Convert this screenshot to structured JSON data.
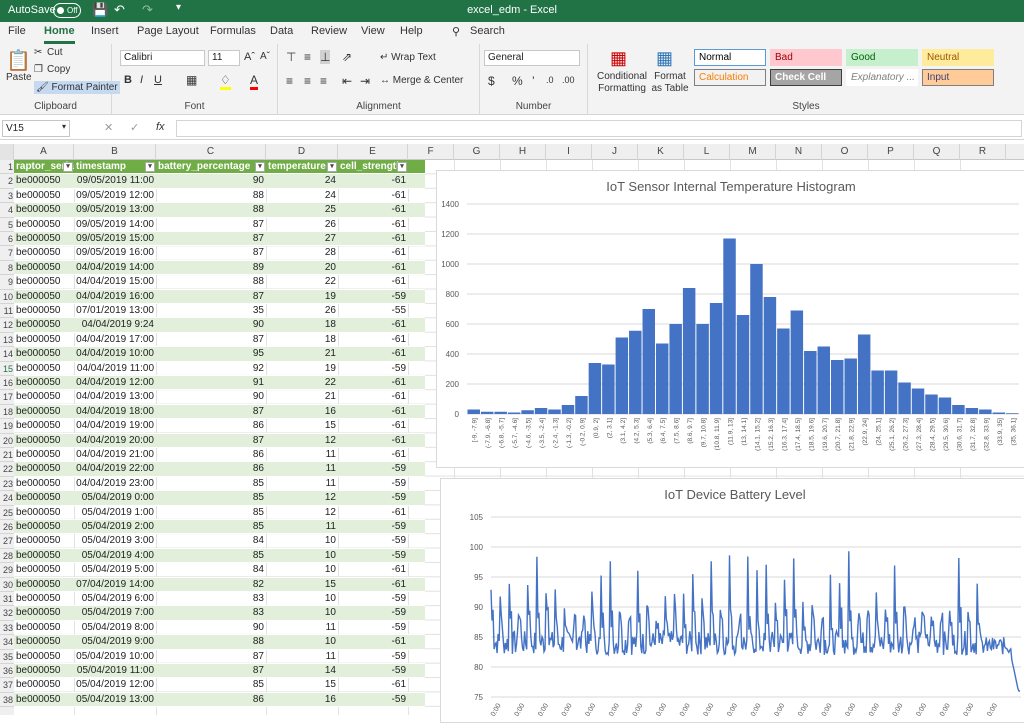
{
  "titlebar": {
    "autosave": "AutoSave",
    "autosave_state": "Off",
    "title": "excel_edm  -  Excel"
  },
  "tabs": [
    {
      "label": "File",
      "x": 8
    },
    {
      "label": "Home",
      "x": 44,
      "active": true
    },
    {
      "label": "Insert",
      "x": 91
    },
    {
      "label": "Page Layout",
      "x": 137
    },
    {
      "label": "Formulas",
      "x": 210
    },
    {
      "label": "Data",
      "x": 270
    },
    {
      "label": "Review",
      "x": 311
    },
    {
      "label": "View",
      "x": 361
    },
    {
      "label": "Help",
      "x": 400
    }
  ],
  "search_label": "Search",
  "ribbon": {
    "clipboard": {
      "paste": "Paste",
      "cut": "Cut",
      "copy": "Copy",
      "format_painter": "Format Painter",
      "label": "Clipboard"
    },
    "font": {
      "name": "Calibri",
      "size": "11",
      "label": "Font"
    },
    "alignment": {
      "wrap": "Wrap Text",
      "merge": "Merge & Center",
      "label": "Alignment"
    },
    "number": {
      "format": "General",
      "label": "Number"
    },
    "styles": {
      "conditional": "Conditional Formatting",
      "format_table": "Format as Table",
      "label": "Styles",
      "cells": [
        {
          "label": "Normal",
          "bg": "#ffffff",
          "fg": "#000000",
          "border": "#5b9bd5"
        },
        {
          "label": "Bad",
          "bg": "#ffc7ce",
          "fg": "#9c0006",
          "border": "#ffc7ce"
        },
        {
          "label": "Good",
          "bg": "#c6efce",
          "fg": "#006100",
          "border": "#c6efce"
        },
        {
          "label": "Neutral",
          "bg": "#ffeb9c",
          "fg": "#9c5700",
          "border": "#ffeb9c"
        },
        {
          "label": "Calculation",
          "bg": "#f2f2f2",
          "fg": "#fa7d00",
          "border": "#7f7f7f"
        },
        {
          "label": "Check Cell",
          "bg": "#a5a5a5",
          "fg": "#ffffff",
          "border": "#3f3f3f"
        },
        {
          "label": "Explanatory ...",
          "bg": "#ffffff",
          "fg": "#7f7f7f",
          "border": "#ffffff"
        },
        {
          "label": "Input",
          "bg": "#ffcc99",
          "fg": "#3f3f76",
          "border": "#7f7f7f"
        }
      ]
    }
  },
  "namebox": "V15",
  "columns": [
    "A",
    "B",
    "C",
    "D",
    "E",
    "F",
    "G",
    "H",
    "I",
    "J",
    "K",
    "L",
    "M",
    "N",
    "O",
    "P",
    "Q",
    "R"
  ],
  "table_headers": [
    "raptor_serial",
    "timestamp",
    "battery_percentage",
    "temperature",
    "cell_strength"
  ],
  "rows": [
    [
      "be000050",
      "09/05/2019 11:00",
      "90",
      "24",
      "-61"
    ],
    [
      "be000050",
      "09/05/2019 12:00",
      "88",
      "24",
      "-61"
    ],
    [
      "be000050",
      "09/05/2019 13:00",
      "88",
      "25",
      "-61"
    ],
    [
      "be000050",
      "09/05/2019 14:00",
      "87",
      "26",
      "-61"
    ],
    [
      "be000050",
      "09/05/2019 15:00",
      "87",
      "27",
      "-61"
    ],
    [
      "be000050",
      "09/05/2019 16:00",
      "87",
      "28",
      "-61"
    ],
    [
      "be000050",
      "04/04/2019 14:00",
      "89",
      "20",
      "-61"
    ],
    [
      "be000050",
      "04/04/2019 15:00",
      "88",
      "22",
      "-61"
    ],
    [
      "be000050",
      "04/04/2019 16:00",
      "87",
      "19",
      "-59"
    ],
    [
      "be000050",
      "07/01/2019 13:00",
      "35",
      "26",
      "-55"
    ],
    [
      "be000050",
      "04/04/2019 9:24",
      "90",
      "18",
      "-61"
    ],
    [
      "be000050",
      "04/04/2019 17:00",
      "87",
      "18",
      "-61"
    ],
    [
      "be000050",
      "04/04/2019 10:00",
      "95",
      "21",
      "-61"
    ],
    [
      "be000050",
      "04/04/2019 11:00",
      "92",
      "19",
      "-59"
    ],
    [
      "be000050",
      "04/04/2019 12:00",
      "91",
      "22",
      "-61"
    ],
    [
      "be000050",
      "04/04/2019 13:00",
      "90",
      "21",
      "-61"
    ],
    [
      "be000050",
      "04/04/2019 18:00",
      "87",
      "16",
      "-61"
    ],
    [
      "be000050",
      "04/04/2019 19:00",
      "86",
      "15",
      "-61"
    ],
    [
      "be000050",
      "04/04/2019 20:00",
      "87",
      "12",
      "-61"
    ],
    [
      "be000050",
      "04/04/2019 21:00",
      "86",
      "11",
      "-61"
    ],
    [
      "be000050",
      "04/04/2019 22:00",
      "86",
      "11",
      "-59"
    ],
    [
      "be000050",
      "04/04/2019 23:00",
      "85",
      "11",
      "-59"
    ],
    [
      "be000050",
      "05/04/2019 0:00",
      "85",
      "12",
      "-59"
    ],
    [
      "be000050",
      "05/04/2019 1:00",
      "85",
      "12",
      "-61"
    ],
    [
      "be000050",
      "05/04/2019 2:00",
      "85",
      "11",
      "-59"
    ],
    [
      "be000050",
      "05/04/2019 3:00",
      "84",
      "10",
      "-59"
    ],
    [
      "be000050",
      "05/04/2019 4:00",
      "85",
      "10",
      "-59"
    ],
    [
      "be000050",
      "05/04/2019 5:00",
      "84",
      "10",
      "-61"
    ],
    [
      "be000050",
      "07/04/2019 14:00",
      "82",
      "15",
      "-61"
    ],
    [
      "be000050",
      "05/04/2019 6:00",
      "83",
      "10",
      "-59"
    ],
    [
      "be000050",
      "05/04/2019 7:00",
      "83",
      "10",
      "-59"
    ],
    [
      "be000050",
      "05/04/2019 8:00",
      "90",
      "11",
      "-59"
    ],
    [
      "be000050",
      "05/04/2019 9:00",
      "88",
      "10",
      "-61"
    ],
    [
      "be000050",
      "05/04/2019 10:00",
      "87",
      "11",
      "-59"
    ],
    [
      "be000050",
      "05/04/2019 11:00",
      "87",
      "14",
      "-59"
    ],
    [
      "be000050",
      "05/04/2019 12:00",
      "85",
      "15",
      "-61"
    ],
    [
      "be000050",
      "05/04/2019 13:00",
      "86",
      "16",
      "-59"
    ]
  ],
  "chart_data": [
    {
      "type": "bar",
      "title": "IoT Sensor Internal Temperature Histogram",
      "ylim": [
        0,
        1400
      ],
      "yticks": [
        0,
        200,
        400,
        600,
        800,
        1000,
        1200,
        1400
      ],
      "color": "#4472c4",
      "categories": [
        "[-9, -7.9]",
        "(-7.9, -6.8]",
        "(-6.8, -5.7]",
        "(-5.7, -4.6]",
        "(-4.6, -3.5]",
        "(-3.5, -2.4]",
        "(-2.4, -1.3]",
        "(-1.3, -0.2]",
        "(-0.2, 0.9]",
        "(0.9, 2]",
        "(2, 3.1]",
        "(3.1, 4.2]",
        "(4.2, 5.3]",
        "(5.3, 6.4]",
        "(6.4, 7.5]",
        "(7.5, 8.6]",
        "(8.6, 9.7]",
        "(9.7, 10.8]",
        "(10.8, 11.9]",
        "(11.9, 13]",
        "(13, 14.1]",
        "(14.1, 15.2]",
        "(15.2, 16.3]",
        "(16.3, 17.4]",
        "(17.4, 18.5]",
        "(18.5, 19.6]",
        "(19.6, 20.7]",
        "(20.7, 21.8]",
        "(21.8, 22.9]",
        "(22.9, 24]",
        "(24, 25.1]",
        "(25.1, 26.2]",
        "(26.2, 27.3]",
        "(27.3, 28.4]",
        "(28.4, 29.5]",
        "(29.5, 30.6]",
        "(30.6, 31.7]",
        "(31.7, 32.8]",
        "(32.8, 33.9]",
        "(33.9, 35]",
        "(35, 36.1]"
      ],
      "values": [
        30,
        15,
        15,
        10,
        25,
        40,
        30,
        60,
        120,
        340,
        330,
        510,
        555,
        700,
        470,
        600,
        840,
        600,
        740,
        1170,
        660,
        1000,
        780,
        570,
        690,
        420,
        450,
        360,
        370,
        530,
        290,
        290,
        210,
        170,
        130,
        110,
        60,
        40,
        30,
        10,
        5
      ]
    },
    {
      "type": "line",
      "title": "IoT Device Battery Level",
      "ylim": [
        75,
        105
      ],
      "yticks": [
        75,
        80,
        85,
        90,
        95,
        100,
        105
      ],
      "color": "#4472c4",
      "x_tick_labels": [
        "0:00",
        "0:00",
        "0:00",
        "0:00",
        "0:00",
        "0:00",
        "0:00",
        "0:00",
        "0:00",
        "0:00",
        "0:00",
        "0:00",
        "0:00",
        "0:00",
        "0:00",
        "0:00",
        "0:00",
        "0:00",
        "0:00",
        "0:00",
        "0:00",
        "0:00"
      ]
    }
  ]
}
